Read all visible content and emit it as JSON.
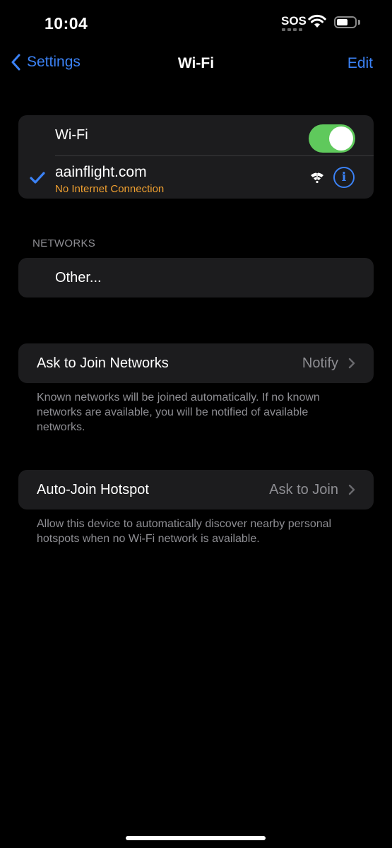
{
  "status_bar": {
    "time": "10:04",
    "carrier": "SOS",
    "wifi_icon": "wifi-icon",
    "battery_icon": "battery-icon"
  },
  "nav": {
    "back_label": "Settings",
    "title": "Wi-Fi",
    "edit_label": "Edit"
  },
  "wifi_group": {
    "toggle_label": "Wi-Fi",
    "toggle_on": true,
    "connected_network": {
      "name": "aainflight.com",
      "status": "No Internet Connection",
      "status_color": "#f0a030"
    }
  },
  "networks": {
    "header": "NETWORKS",
    "other_label": "Other..."
  },
  "ask_to_join": {
    "label": "Ask to Join Networks",
    "value": "Notify",
    "footer": "Known networks will be joined automatically. If no known networks are available, you will be notified of available networks."
  },
  "auto_join_hotspot": {
    "label": "Auto-Join Hotspot",
    "value": "Ask to Join",
    "footer": "Allow this device to automatically discover nearby personal hotspots when no Wi-Fi network is available."
  },
  "colors": {
    "accent": "#3b82f6",
    "toggle_on": "#5fc95c",
    "cell_bg": "#1c1c1e",
    "secondary_text": "#8e8e93"
  }
}
